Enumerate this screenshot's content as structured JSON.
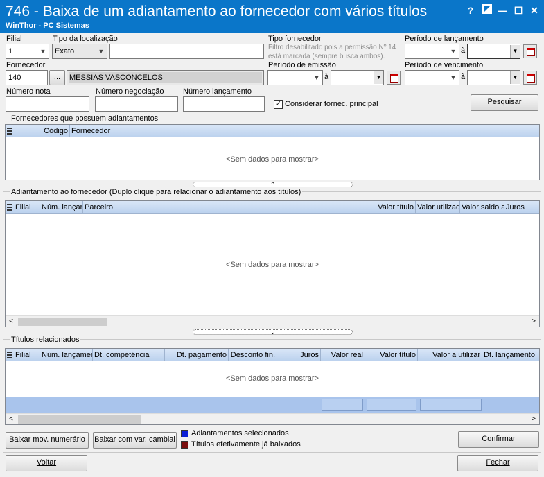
{
  "window": {
    "title": "746 - Baixa de um adiantamento ao fornecedor com vários títulos",
    "subtitle": "WinThor - PC Sistemas",
    "help": "?",
    "minimize": "—",
    "maximize": "☐",
    "close": "✕"
  },
  "filters": {
    "filial_label": "Filial",
    "filial_value": "1",
    "tipo_localizacao_label": "Tipo da localização",
    "tipo_localizacao_value": "Exato",
    "tipo_fornecedor_label": "Tipo fornecedor",
    "tipo_fornecedor_note": "Filtro desabilitado pois a permissão Nº 14 está marcada (sempre busca ambos).",
    "periodo_lancamento_label": "Período de lançamento",
    "a1": "à",
    "fornecedor_label": "Fornecedor",
    "fornecedor_code": "140",
    "fornecedor_browse": "...",
    "fornecedor_name": "MESSIAS VASCONCELOS",
    "periodo_emissao_label": "Período de emissão",
    "a2": "à",
    "periodo_vencimento_label": "Período de vencimento",
    "a3": "à",
    "numero_nota_label": "Número nota",
    "numero_negociacao_label": "Número negociação",
    "numero_lancamento_label": "Número lançamento",
    "considerar_label": "Considerar fornec. principal",
    "considerar_checked": "✓",
    "pesquisar": "Pesquisar"
  },
  "grid_fornecedores": {
    "title": "Fornecedores que possuem adiantamentos",
    "columns": [
      "Código",
      "Fornecedor"
    ],
    "empty": "<Sem dados para mostrar>"
  },
  "grid_adiantamento": {
    "title": "Adiantamento ao fornecedor (Duplo clique para relacionar o adiantamento aos títulos)",
    "columns": [
      "Filial",
      "Núm. lançam",
      "Parceiro",
      "Valor título",
      "Valor utilizad",
      "Valor saldo a",
      "Juros"
    ],
    "empty": "<Sem dados para mostrar>"
  },
  "grid_titulos": {
    "title": "Títulos relacionados",
    "columns": [
      "Filial",
      "Núm. lançamer",
      "Dt. competência",
      "Dt. pagamento",
      "Desconto fin.",
      "Juros",
      "Valor real",
      "Valor título",
      "Valor a utilizar",
      "Dt. lançamento"
    ],
    "empty": "<Sem dados para mostrar>"
  },
  "footer": {
    "baixar_numerario": "Baixar mov. numerário",
    "baixar_cambial": "Baixar com var. cambial",
    "legend_selecionados": "Adiantamentos selecionados",
    "legend_baixados": "Títulos efetivamente já baixados",
    "legend_color_selecionados": "#0a1ed6",
    "legend_color_baixados": "#7a0e0e",
    "confirmar": "Confirmar",
    "voltar": "Voltar",
    "fechar": "Fechar"
  },
  "colors": {
    "titlebar": "#0a76c9",
    "grid_header": "#bcd2ee",
    "summary_row": "#a9c4ec"
  }
}
